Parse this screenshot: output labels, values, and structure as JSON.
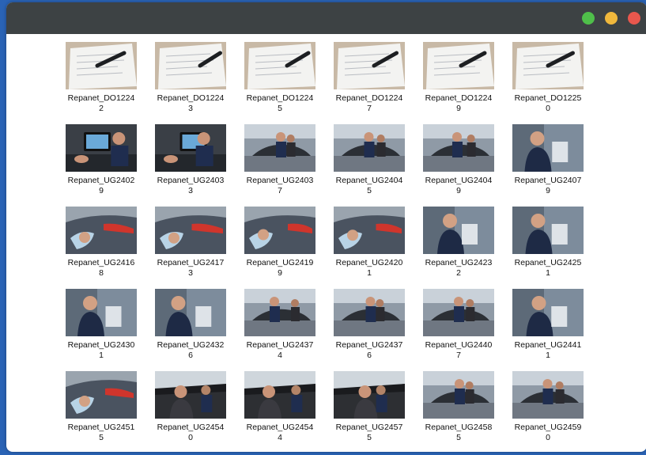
{
  "window": {
    "controls": [
      {
        "name": "maximize-button",
        "color": "#4fbf4a"
      },
      {
        "name": "minimize-button",
        "color": "#f0b83c"
      },
      {
        "name": "close-button",
        "color": "#e8574d"
      }
    ]
  },
  "files": [
    {
      "line1": "Repanet_DO1224",
      "line2": "2",
      "kind": "paper"
    },
    {
      "line1": "Repanet_DO1224",
      "line2": "3",
      "kind": "paper"
    },
    {
      "line1": "Repanet_DO1224",
      "line2": "5",
      "kind": "paper"
    },
    {
      "line1": "Repanet_DO1224",
      "line2": "7",
      "kind": "paper"
    },
    {
      "line1": "Repanet_DO1224",
      "line2": "9",
      "kind": "paper"
    },
    {
      "line1": "Repanet_DO1225",
      "line2": "0",
      "kind": "paper"
    },
    {
      "line1": "Repanet_UG2402",
      "line2": "9",
      "kind": "tablet"
    },
    {
      "line1": "Repanet_UG2403",
      "line2": "3",
      "kind": "tablet"
    },
    {
      "line1": "Repanet_UG2403",
      "line2": "7",
      "kind": "workshop"
    },
    {
      "line1": "Repanet_UG2404",
      "line2": "5",
      "kind": "workshop"
    },
    {
      "line1": "Repanet_UG2404",
      "line2": "9",
      "kind": "workshop"
    },
    {
      "line1": "Repanet_UG2407",
      "line2": "9",
      "kind": "person"
    },
    {
      "line1": "Repanet_UG2416",
      "line2": "8",
      "kind": "car"
    },
    {
      "line1": "Repanet_UG2417",
      "line2": "3",
      "kind": "car"
    },
    {
      "line1": "Repanet_UG2419",
      "line2": "9",
      "kind": "car"
    },
    {
      "line1": "Repanet_UG2420",
      "line2": "1",
      "kind": "car"
    },
    {
      "line1": "Repanet_UG2423",
      "line2": "2",
      "kind": "person"
    },
    {
      "line1": "Repanet_UG2425",
      "line2": "1",
      "kind": "person"
    },
    {
      "line1": "Repanet_UG2430",
      "line2": "1",
      "kind": "person"
    },
    {
      "line1": "Repanet_UG2432",
      "line2": "6",
      "kind": "person"
    },
    {
      "line1": "Repanet_UG2437",
      "line2": "4",
      "kind": "workshop"
    },
    {
      "line1": "Repanet_UG2437",
      "line2": "6",
      "kind": "workshop"
    },
    {
      "line1": "Repanet_UG2440",
      "line2": "7",
      "kind": "workshop"
    },
    {
      "line1": "Repanet_UG2441",
      "line2": "1",
      "kind": "person"
    },
    {
      "line1": "Repanet_UG2451",
      "line2": "5",
      "kind": "car"
    },
    {
      "line1": "Repanet_UG2454",
      "line2": "0",
      "kind": "interior"
    },
    {
      "line1": "Repanet_UG2454",
      "line2": "4",
      "kind": "interior"
    },
    {
      "line1": "Repanet_UG2457",
      "line2": "5",
      "kind": "interior"
    },
    {
      "line1": "Repanet_UG2458",
      "line2": "5",
      "kind": "workshop"
    },
    {
      "line1": "Repanet_UG2459",
      "line2": "0",
      "kind": "workshop"
    }
  ]
}
